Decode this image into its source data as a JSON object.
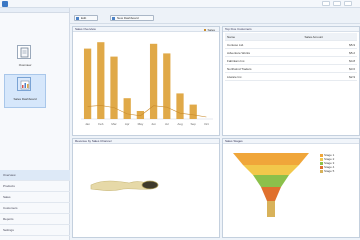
{
  "window": {
    "minimize_icon": "minimize-icon",
    "maximize_icon": "maximize-icon",
    "close_icon": "close-icon"
  },
  "sidebar": {
    "tiles": [
      {
        "label": "Overview",
        "icon": "document-icon"
      },
      {
        "label": "Sales Dashboard",
        "icon": "chart-icon"
      }
    ],
    "items": [
      "Overview",
      "Products",
      "Sales",
      "Customers",
      "Reports",
      "Settings"
    ]
  },
  "toolbar": {
    "btn1": "Edit",
    "btn2": "New Dashboard"
  },
  "sales_panel": {
    "title": "Sales Overview",
    "legend": "Sales"
  },
  "chart_data": {
    "type": "bar",
    "categories": [
      "Jan",
      "Feb",
      "Mar",
      "Apr",
      "May",
      "Jun",
      "Jul",
      "Aug",
      "Sep",
      "Oct"
    ],
    "series": [
      {
        "values": [
          88,
          96,
          78,
          26,
          10,
          94,
          82,
          32,
          18,
          0
        ]
      },
      {
        "values": [
          0,
          0,
          0,
          0,
          5,
          0,
          0,
          0,
          0,
          0
        ]
      }
    ],
    "ylim": [
      0,
      100
    ],
    "bar_color": "#e0a948",
    "line_color": "#c98b2c"
  },
  "top_panel": {
    "title": "Top Five Customers",
    "headers": [
      "Name",
      "Sales Amount"
    ],
    "rows": [
      {
        "name": "Contoso Ltd.",
        "value": "$5.9"
      },
      {
        "name": "Adventure Works",
        "value": "$5.2"
      },
      {
        "name": "Fabrikam Inc.",
        "value": "$4.8"
      },
      {
        "name": "Northwind Traders",
        "value": "$3.6"
      },
      {
        "name": "Litware Inc.",
        "value": "$2.9"
      }
    ]
  },
  "map_panel": {
    "title": "Revenue by Sales Channel"
  },
  "funnel_panel": {
    "title": "Sales Stages",
    "legend": [
      {
        "label": "Stage 1",
        "color": "#f0a63a"
      },
      {
        "label": "Stage 2",
        "color": "#f2c84b"
      },
      {
        "label": "Stage 3",
        "color": "#8cc04b"
      },
      {
        "label": "Stage 4",
        "color": "#e0702d"
      },
      {
        "label": "Stage 5",
        "color": "#d8b25a"
      }
    ]
  }
}
